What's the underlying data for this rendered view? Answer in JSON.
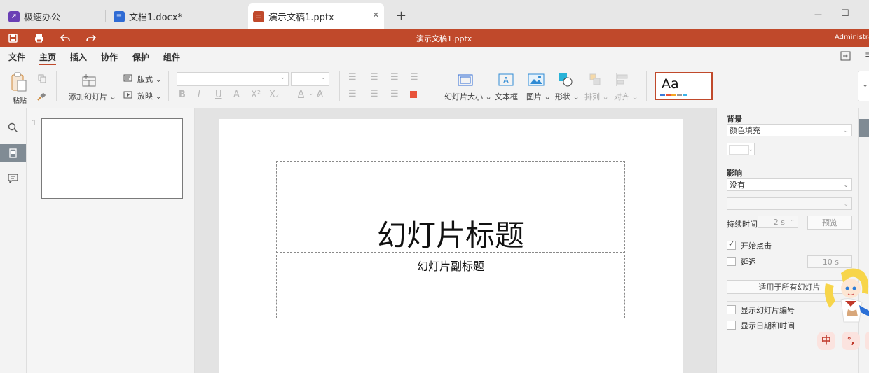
{
  "tabs": [
    {
      "label": "极速办公",
      "icon": "rocket-icon",
      "color": "#6a3fb5"
    },
    {
      "label": "文档1.docx*",
      "icon": "document-icon",
      "color": "#2f6bd4"
    },
    {
      "label": "演示文稿1.pptx",
      "icon": "presentation-icon",
      "color": "#c0492b"
    }
  ],
  "tab_close": "✕",
  "new_tab": "+",
  "window_controls": {
    "minimize": "—",
    "maximize": "☐"
  },
  "titlebar": {
    "doc_title": "演示文稿1.pptx",
    "user": "Administra"
  },
  "menu": [
    "文件",
    "主页",
    "插入",
    "协作",
    "保护",
    "组件"
  ],
  "ribbon": {
    "paste": "粘贴",
    "add_slide": "添加幻灯片",
    "layout": "版式",
    "play": "放映",
    "bold": "B",
    "italic": "I",
    "underline": "U",
    "strike": "A",
    "superscript": "X²",
    "subscript": "X₂",
    "font_color": "A",
    "slide_size": "幻灯片大小",
    "textbox": "文本框",
    "picture": "图片",
    "shape": "形状",
    "arrange": "排列",
    "align": "对齐",
    "theme_sample": "Aa"
  },
  "slide_number": "1",
  "slide": {
    "title": "幻灯片标题",
    "subtitle": "幻灯片副标题"
  },
  "panel": {
    "background_label": "背景",
    "background_value": "颜色填充",
    "effect_label": "影响",
    "effect_value": "没有",
    "duration_label": "持续时间",
    "duration_value": "2 s",
    "preview": "预览",
    "start_on_click": "开始点击",
    "delay": "延迟",
    "delay_value": "10 s",
    "apply_all": "适用于所有幻灯片",
    "show_slide_number": "显示幻灯片编号",
    "show_date_time": "显示日期和时间"
  },
  "ime": {
    "chinese": "中",
    "punct": "°,"
  },
  "accent_color": "#c0492b"
}
